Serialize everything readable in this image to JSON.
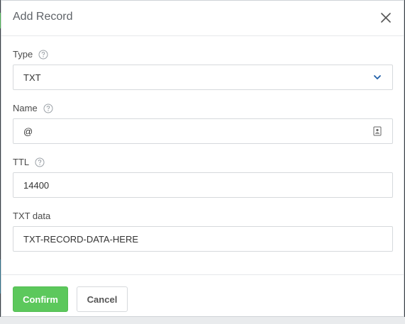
{
  "dialog": {
    "title": "Add Record",
    "close_icon": "close-icon"
  },
  "fields": {
    "type": {
      "label": "Type",
      "value": "TXT",
      "help_icon": "help-circle-icon",
      "dropdown_icon": "chevron-down-icon"
    },
    "name": {
      "label": "Name",
      "value": "@",
      "help_icon": "help-circle-icon",
      "trailing_icon": "contact-card-icon"
    },
    "ttl": {
      "label": "TTL",
      "value": "14400",
      "help_icon": "help-circle-icon"
    },
    "txt_data": {
      "label": "TXT data",
      "value": "TXT-RECORD-DATA-HERE"
    }
  },
  "footer": {
    "confirm_label": "Confirm",
    "cancel_label": "Cancel"
  },
  "colors": {
    "confirm_bg": "#5cc85c",
    "chevron": "#1f5fa8",
    "border": "#d6d9dc"
  }
}
